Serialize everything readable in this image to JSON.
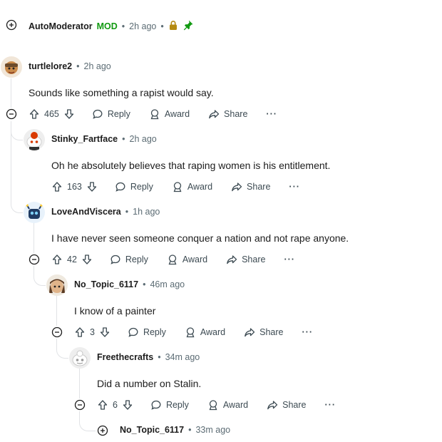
{
  "labels": {
    "reply": "Reply",
    "award": "Award",
    "share": "Share",
    "more": "···",
    "dot": "•"
  },
  "comments": [
    {
      "author": "AutoModerator",
      "flair": "MOD",
      "time": "2h ago",
      "collapsed": true,
      "icons": [
        "lock-icon",
        "pin-icon"
      ]
    },
    {
      "author": "turtlelore2",
      "time": "2h ago",
      "body": "Sounds like something a rapist would say.",
      "votes": "465"
    },
    {
      "author": "Stinky_Fartface",
      "time": "2h ago",
      "body": "Oh he absolutely believes that raping women is his entitlement.",
      "votes": "163"
    },
    {
      "author": "LoveAndViscera",
      "time": "1h ago",
      "body": "I have never seen someone conquer a nation and not rape anyone.",
      "votes": "42"
    },
    {
      "author": "No_Topic_6117",
      "time": "46m ago",
      "body": "I know of a painter",
      "votes": "3"
    },
    {
      "author": "Freethecrafts",
      "time": "34m ago",
      "body": "Did a number on Stalin.",
      "votes": "6"
    },
    {
      "author": "No_Topic_6117",
      "time": "33m ago",
      "collapsed": true
    }
  ],
  "colors": {
    "mod": "#119a11",
    "lock": "#b58a11",
    "pin": "#119a11",
    "thread_line": "#e1e3e6",
    "meta_text": "#5c6c74"
  }
}
